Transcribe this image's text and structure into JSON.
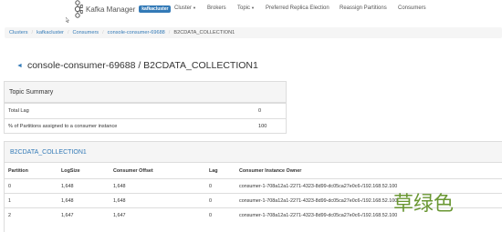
{
  "navbar": {
    "brand": "Kafka Manager",
    "cluster_badge": "kafkacluster",
    "items": [
      {
        "label": "Cluster",
        "dropdown": true
      },
      {
        "label": "Brokers",
        "dropdown": false
      },
      {
        "label": "Topic",
        "dropdown": true
      },
      {
        "label": "Preferred Replica Election",
        "dropdown": false
      },
      {
        "label": "Reassign Partitions",
        "dropdown": false
      },
      {
        "label": "Consumers",
        "dropdown": false
      }
    ]
  },
  "breadcrumb": {
    "items": [
      "Clusters",
      "kafkacluster",
      "Consumers",
      "console-consumer-69688"
    ],
    "active": "B2CDATA_COLLECTION1"
  },
  "page": {
    "title": "console-consumer-69688 / B2CDATA_COLLECTION1"
  },
  "topic_summary": {
    "heading": "Topic Summary",
    "rows": [
      {
        "label": "Total Lag",
        "value": "0"
      },
      {
        "label": "% of Partitions assigned to a consumer instance",
        "value": "100"
      }
    ]
  },
  "topic_panel": {
    "heading": "B2CDATA_COLLECTION1",
    "columns": [
      "Partition",
      "LogSize",
      "Consumer Offset",
      "Lag",
      "Consumer Instance Owner"
    ],
    "rows": [
      [
        "0",
        "1,648",
        "1,648",
        "0",
        "consumer-1-708a12a1-2271-4323-8d99-dc05ca27e0c6-/192.168.52.100"
      ],
      [
        "1",
        "1,648",
        "1,648",
        "0",
        "consumer-1-708a12a1-2271-4323-8d99-dc05ca27e0c6-/192.168.52.100"
      ],
      [
        "2",
        "1,647",
        "1,647",
        "0",
        "consumer-1-708a12a1-2271-4323-8d99-dc05ca27e0c6-/192.168.52.100"
      ]
    ]
  },
  "watermark": "草绿色",
  "colors": {
    "link": "#337ab7",
    "badge": "#337ab7",
    "panel_head": "#f5f5f5",
    "watermark": "#5a8c1e"
  }
}
